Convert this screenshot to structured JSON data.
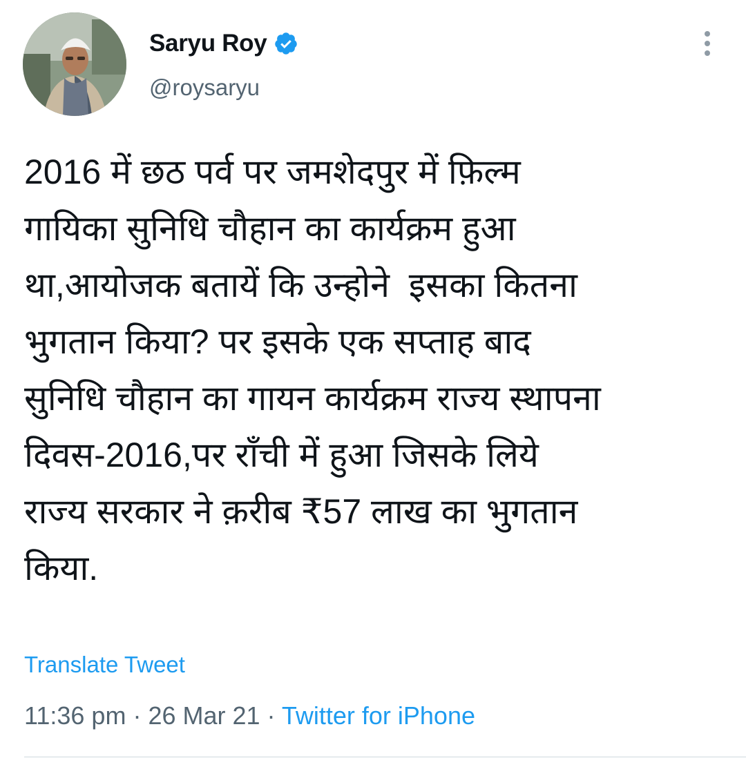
{
  "author": {
    "display_name": "Saryu Roy",
    "handle": "@roysaryu",
    "verified": true,
    "avatar_icon": "profile-photo"
  },
  "tweet": {
    "text": "2016 में छठ पर्व पर जमशेदपुर में फ़िल्म\nगायिका सुनिधि चौहान का कार्यक्रम हुआ\nथा,आयोजक बतायें कि उन्होने  इसका कितना\nभुगतान किया? पर इसके एक सप्ताह बाद\nसुनिधि चौहान का गायन कार्यक्रम राज्य स्थापना\nदिवस-2016,पर राँची में हुआ जिसके लिये\nराज्य सरकार ने क़रीब ₹57 लाख का भुगतान\nकिया.",
    "translate_label": "Translate Tweet",
    "time": "11:36 pm",
    "separator": " · ",
    "date": "26 Mar 21",
    "source": "Twitter for iPhone"
  },
  "colors": {
    "link": "#1d9bf0",
    "secondary_text": "#536471",
    "primary_text": "#0f1419"
  },
  "icons": {
    "verified": "verified-badge-icon",
    "more": "more-options-icon"
  }
}
